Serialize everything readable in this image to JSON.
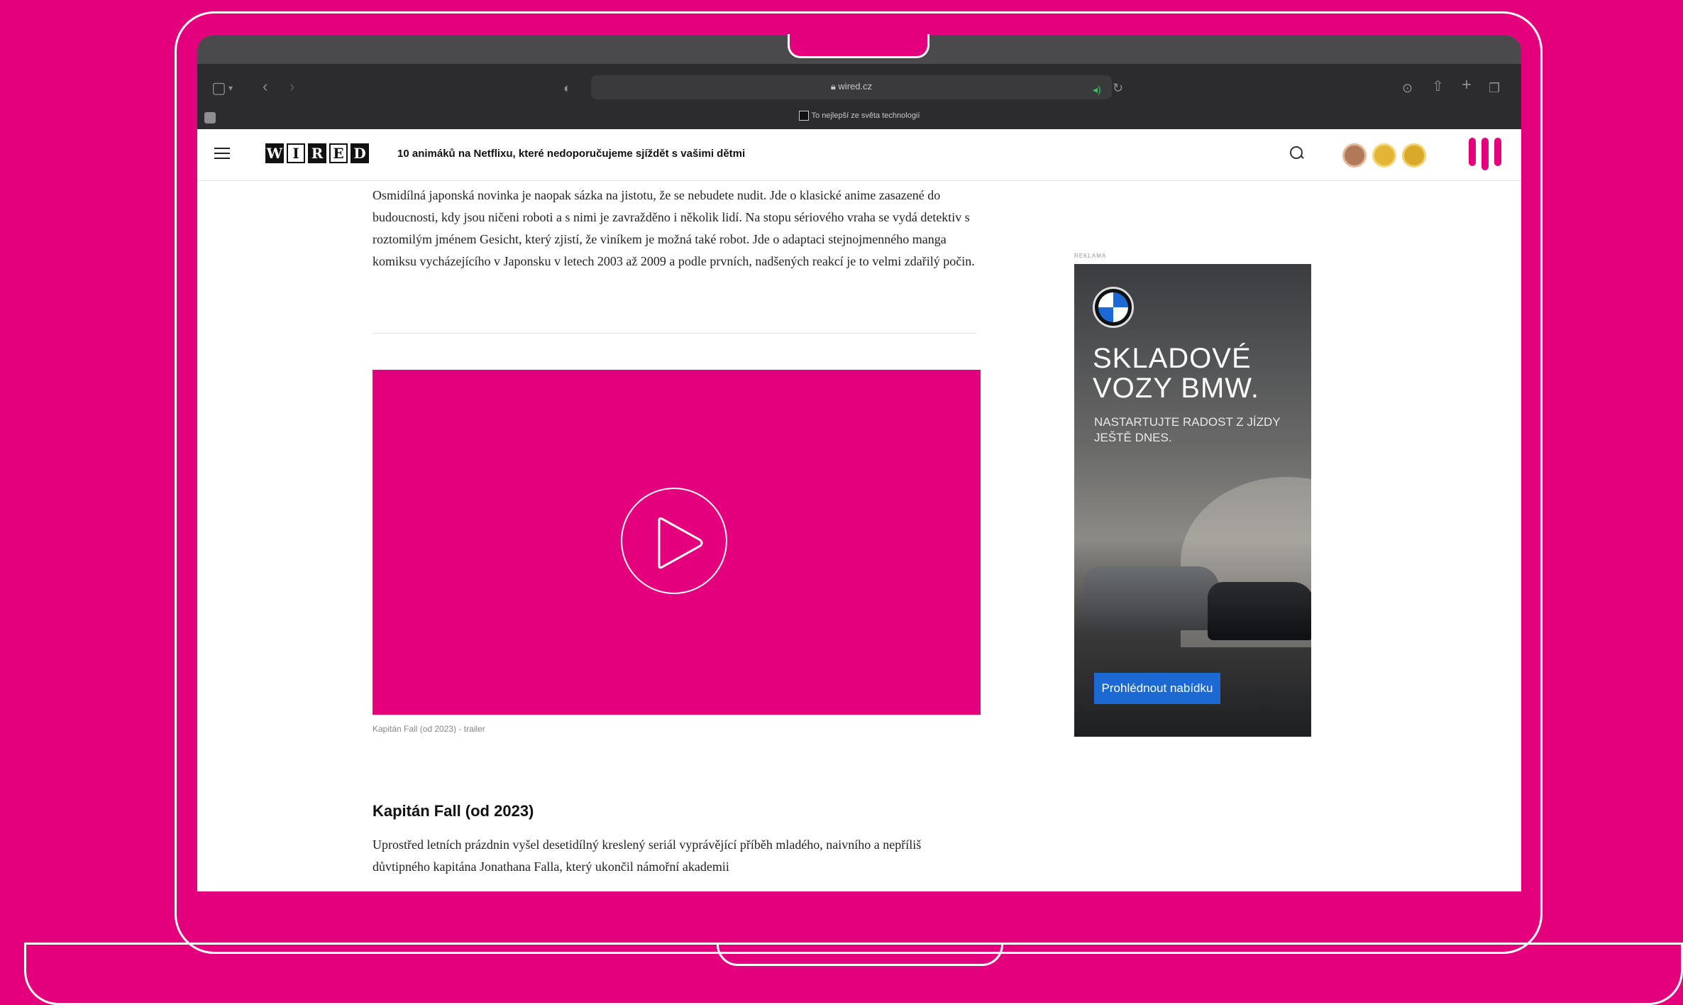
{
  "browser": {
    "url": "wired.cz",
    "tab_title": "To nejlepší ze světa technologií",
    "icons": [
      "sidebar-icon",
      "chevron-down-icon",
      "back-icon",
      "forward-icon",
      "shield-icon",
      "lock-icon",
      "sound-icon",
      "reload-icon",
      "download-icon",
      "share-icon",
      "plus-icon",
      "tabs-icon"
    ]
  },
  "header": {
    "logo": [
      "W",
      "I",
      "R",
      "E",
      "D"
    ],
    "title": "10 animáků na Netflixu, které nedoporučujeme sjíždět s vašimi dětmi"
  },
  "article": {
    "paragraph1": "Osmidílná japonská novinka je naopak sázka na jistotu, že se nebudete nudit. Jde o klasické anime zasazené do budoucnosti, kdy jsou ničeni roboti a s nimi je zavražděno i několik lidí. Na stopu sériového vraha se vydá detektiv s roztomilým jménem Gesicht, který zjistí, že viníkem je možná také robot. Jde o adaptaci stejnojmenného manga komiksu vycházejícího v Japonsku v letech 2003 až 2009 a podle prvních, nadšených reakcí je to velmi zdařilý počin.",
    "video_caption": "Kapitán Fall (od 2023) - trailer",
    "subheading": "Kapitán Fall (od 2023)",
    "paragraph2": "Uprostřed letních prázdnin vyšel desetidílný kreslený seriál vyprávějící příběh mladého, naivního a nepříliš důvtipného kapitána Jonathana Falla, který ukončil námořní akademii"
  },
  "ad": {
    "label": "REKLAMA",
    "headline": "SKLADOVÉ VOZY BMW.",
    "subline": "NASTARTUJTE RADOST Z JÍZDY JEŠTĚ DNES.",
    "cta": "Prohlédnout nabídku"
  },
  "colors": {
    "background": "#e4007c",
    "video": "#e4007c",
    "cta": "#1c69d4"
  }
}
